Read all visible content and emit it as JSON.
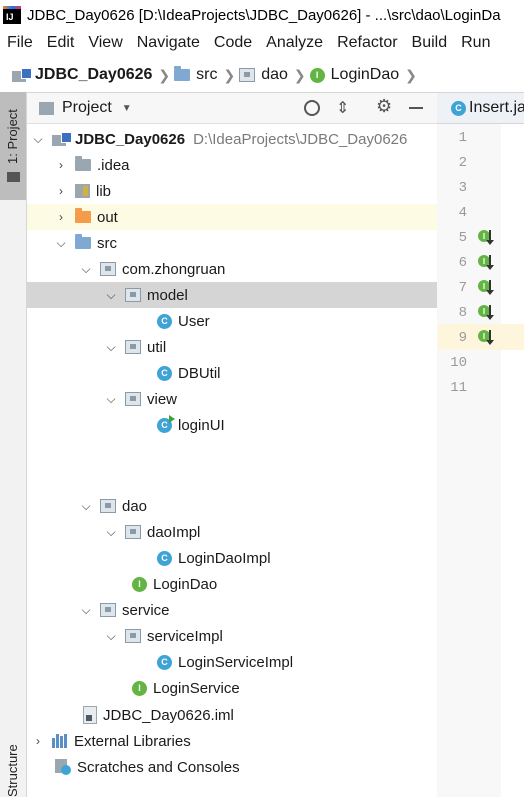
{
  "window": {
    "title": "JDBC_Day0626 [D:\\IdeaProjects\\JDBC_Day0626] - ...\\src\\dao\\LoginDa"
  },
  "menu": [
    "File",
    "Edit",
    "View",
    "Navigate",
    "Code",
    "Analyze",
    "Refactor",
    "Build",
    "Run"
  ],
  "breadcrumb": [
    "JDBC_Day0626",
    "src",
    "dao",
    "LoginDao"
  ],
  "sidebar": {
    "project_tab": "1: Project",
    "structure_tab": "Structure"
  },
  "panel": {
    "title": "Project"
  },
  "tree": {
    "root_name": "JDBC_Day0626",
    "root_path": "D:\\IdeaProjects\\JDBC_Day0626",
    "idea": ".idea",
    "lib": "lib",
    "out": "out",
    "src": "src",
    "pkg_main": "com.zhongruan",
    "model": "model",
    "user": "User",
    "util": "util",
    "dbutil": "DBUtil",
    "view": "view",
    "loginui": "loginUI",
    "dao": "dao",
    "daoimpl": "daoImpl",
    "logindaoimpl": "LoginDaoImpl",
    "logindao": "LoginDao",
    "service": "service",
    "serviceimpl": "serviceImpl",
    "loginserviceimpl": "LoginServiceImpl",
    "loginservice": "LoginService",
    "iml": "JDBC_Day0626.iml",
    "external_libs": "External Libraries",
    "scratches": "Scratches and Consoles"
  },
  "editor": {
    "tab": "Insert.ja",
    "line_numbers": [
      "1",
      "2",
      "3",
      "4",
      "5",
      "6",
      "7",
      "8",
      "9",
      "10",
      "11"
    ]
  }
}
